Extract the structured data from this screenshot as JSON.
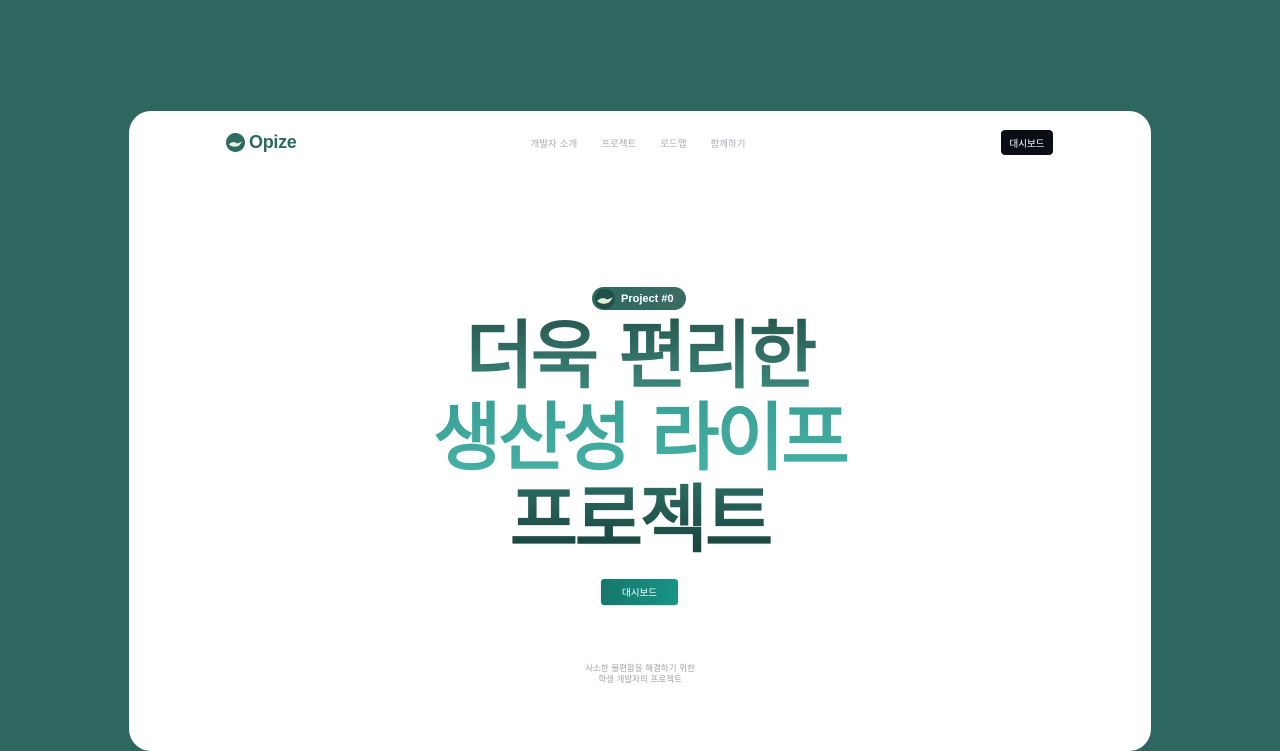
{
  "header": {
    "logo_text": "Opize",
    "logo_icon": "opize-bird-icon",
    "nav": [
      {
        "label": "개발자 소개"
      },
      {
        "label": "프로젝트"
      },
      {
        "label": "로드맵"
      },
      {
        "label": "함께하기"
      }
    ],
    "dashboard_button": "대시보드"
  },
  "hero": {
    "badge": {
      "icon": "opize-bird-icon",
      "label": "Project #0"
    },
    "headline": [
      "더욱 편리한",
      "생산성 라이프",
      "프로젝트"
    ],
    "cta_label": "대시보드",
    "tagline": [
      "사소한 불편함을 해결하기 위한",
      "학생 개발자의 프로젝트"
    ]
  },
  "colors": {
    "page_background": "#2e6760",
    "brand": "#2d6a60",
    "accent": "#3aa096",
    "dark_button": "#0b0d14",
    "cta": "#15776b"
  }
}
